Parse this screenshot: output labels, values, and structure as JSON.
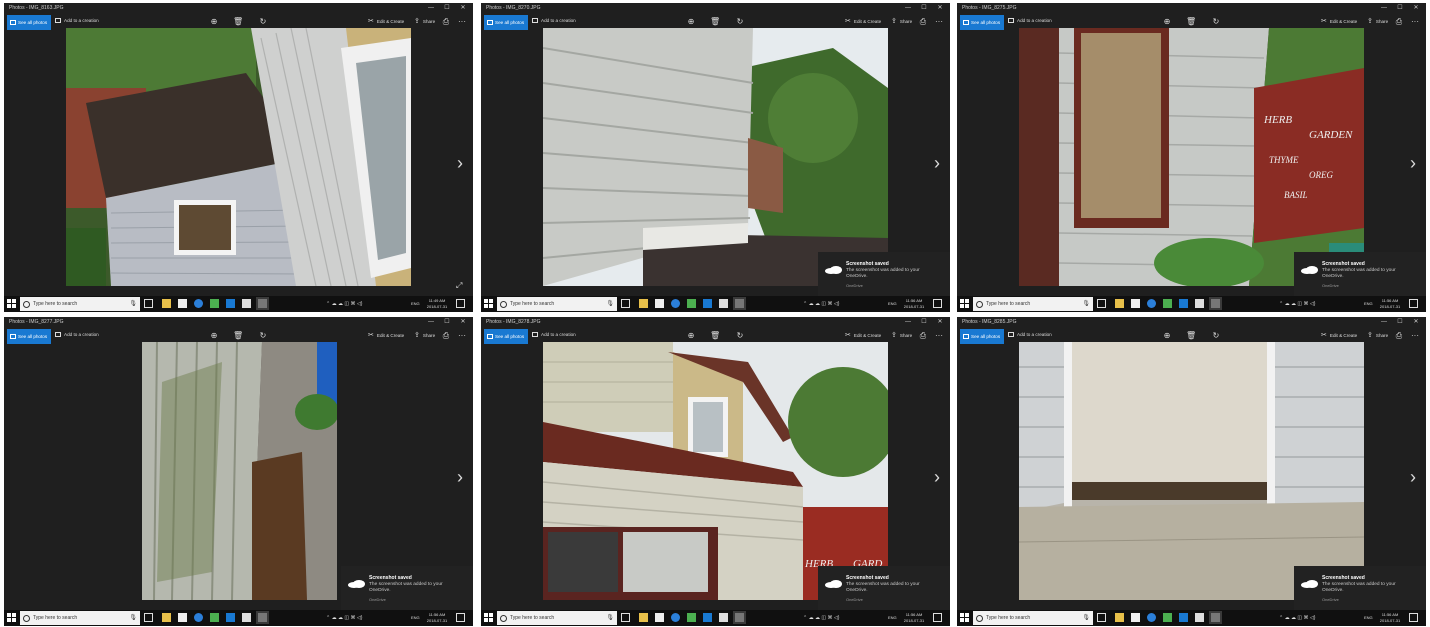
{
  "app": {
    "see_all_label": "See all photos",
    "add_label": "Add to a creation",
    "edit_label": "Edit & Create",
    "share_label": "Share",
    "more_label": "···",
    "zoom_icon": "zoom-icon",
    "delete_icon": "trash-icon",
    "rotate_icon": "rotate-icon",
    "minimize": "—",
    "maximize": "☐",
    "close": "✕",
    "next": "›",
    "accent": "#1979d2"
  },
  "taskbar": {
    "search_placeholder": "Type here to search",
    "tray_icons": "⌃ ☁ ☁ ◫ ⌘ ◁)",
    "lang": "ENG",
    "time_a": "11:49 AM",
    "time_b": "11:56 AM",
    "date": "2018-07-31"
  },
  "toast": {
    "title": "Screenshot saved",
    "body": "The screenshot was added to your OneDrive.",
    "source": "OneDrive"
  },
  "windows": [
    {
      "title": "Photos - IMG_8163.JPG"
    },
    {
      "title": "Photos - IMG_8270.JPG"
    },
    {
      "title": "Photos - IMG_8275.JPG"
    },
    {
      "title": "Photos - IMG_8277.JPG"
    },
    {
      "title": "Photos - IMG_8278.JPG"
    },
    {
      "title": "Photos - IMG_8285.JPG"
    }
  ]
}
